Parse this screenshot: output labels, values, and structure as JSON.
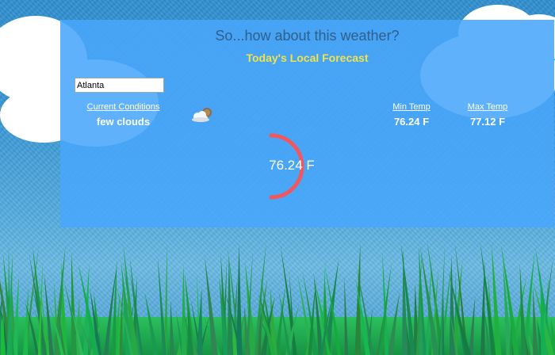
{
  "header": {
    "title": "So...how about this weather?",
    "subtitle": "Today's Local Forecast"
  },
  "search": {
    "value": "Atlanta"
  },
  "conditions": {
    "label": "Current Conditions",
    "value": "few clouds",
    "icon": "partly-cloudy-icon"
  },
  "min_temp": {
    "label": "Min Temp",
    "value": "76.24 F"
  },
  "max_temp": {
    "label": "Max Temp",
    "value": "77.12 F"
  },
  "gauge": {
    "value": "76.24 F",
    "color": "#f0575f"
  },
  "colors": {
    "panel": "#49a6fa",
    "title": "#2f5f8a",
    "subtitle": "#f1e24a",
    "grass": "#1fae52"
  }
}
